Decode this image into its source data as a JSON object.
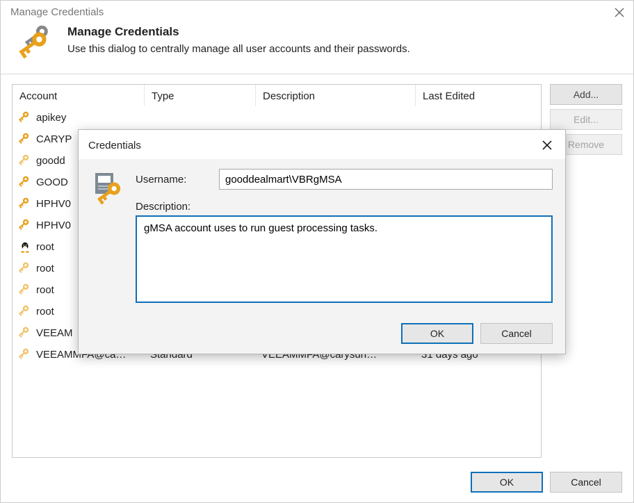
{
  "window": {
    "title": "Manage Credentials",
    "close_icon": "close-icon"
  },
  "header": {
    "title": "Manage Credentials",
    "subtitle": "Use this dialog to centrally manage all user accounts and their passwords."
  },
  "table": {
    "columns": [
      "Account",
      "Type",
      "Description",
      "Last Edited"
    ],
    "rows": [
      {
        "account": "apikey",
        "icon": "orange",
        "type": "",
        "desc": "",
        "edited": ""
      },
      {
        "account": "CARYP",
        "icon": "orange",
        "type": "",
        "desc": "",
        "edited": ""
      },
      {
        "account": "goodd",
        "icon": "light",
        "type": "",
        "desc": "",
        "edited": ""
      },
      {
        "account": "GOOD",
        "icon": "orange",
        "type": "",
        "desc": "",
        "edited": ""
      },
      {
        "account": "HPHV0",
        "icon": "orange",
        "type": "",
        "desc": "",
        "edited": ""
      },
      {
        "account": "HPHV0",
        "icon": "orange",
        "type": "",
        "desc": "",
        "edited": ""
      },
      {
        "account": "root",
        "icon": "linux",
        "type": "",
        "desc": "",
        "edited": ""
      },
      {
        "account": "root",
        "icon": "light",
        "type": "",
        "desc": "",
        "edited": ""
      },
      {
        "account": "root",
        "icon": "light",
        "type": "",
        "desc": "",
        "edited": ""
      },
      {
        "account": "root",
        "icon": "light",
        "type": "",
        "desc": "",
        "edited": ""
      },
      {
        "account": "VEEAM",
        "icon": "light",
        "type": "",
        "desc": "",
        "edited": ""
      },
      {
        "account": "VEEAMMFA@ca…",
        "icon": "light",
        "type": "Standard",
        "desc": "VEEAMMFA@carysun…",
        "edited": "31 days ago"
      }
    ]
  },
  "sidebar": {
    "add": "Add...",
    "edit": "Edit...",
    "remove": "Remove"
  },
  "footer": {
    "ok": "OK",
    "cancel": "Cancel"
  },
  "modal": {
    "title": "Credentials",
    "username_label": "Username:",
    "username_value": "gooddealmart\\VBRgMSA",
    "description_label": "Description:",
    "description_value": "gMSA account uses to run guest processing tasks.",
    "ok": "OK",
    "cancel": "Cancel"
  }
}
